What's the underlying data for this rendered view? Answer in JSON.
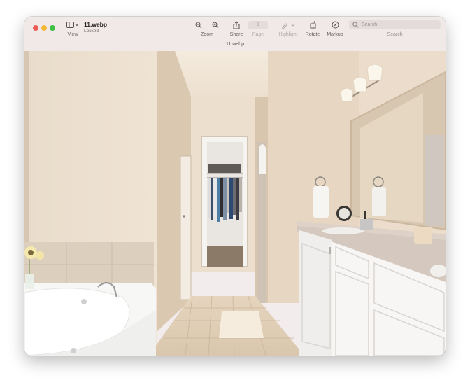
{
  "window": {
    "doc_title": "11.webp",
    "doc_status": "Locked",
    "filename_label": "11.webp"
  },
  "toolbar": {
    "view_label": "View",
    "zoom_label": "Zoom",
    "share_label": "Share",
    "page_value": "1",
    "page_label": "Page",
    "highlight_label": "Highlight",
    "rotate_label": "Rotate",
    "markup_label": "Markup",
    "search_placeholder": "Search",
    "search_label": "Search"
  },
  "icons": [
    "sidebar-icon",
    "chevron-down-icon",
    "zoom-out-icon",
    "zoom-in-icon",
    "share-icon",
    "highlight-icon",
    "rotate-icon",
    "markup-icon",
    "search-icon"
  ],
  "colors": {
    "close": "#ee5b55",
    "minimize": "#f4b731",
    "zoom": "#3fbf45",
    "toolbar": "#f1e8e8"
  }
}
